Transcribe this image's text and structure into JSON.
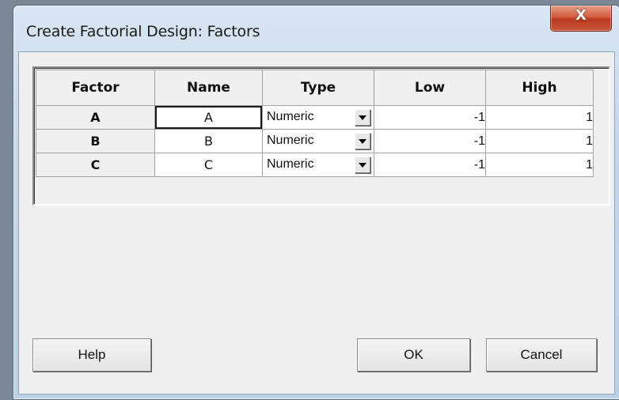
{
  "window": {
    "title": "Create Factorial Design: Factors",
    "close_glyph": "X"
  },
  "grid": {
    "headers": [
      "Factor",
      "Name",
      "Type",
      "Low",
      "High"
    ],
    "rows": [
      {
        "factor": "A",
        "name": "A",
        "type": "Numeric",
        "low": "-1",
        "high": "1"
      },
      {
        "factor": "B",
        "name": "B",
        "type": "Numeric",
        "low": "-1",
        "high": "1"
      },
      {
        "factor": "C",
        "name": "C",
        "type": "Numeric",
        "low": "-1",
        "high": "1"
      }
    ]
  },
  "buttons": {
    "help": "Help",
    "ok": "OK",
    "cancel": "Cancel"
  },
  "icons": {
    "close": "close-icon",
    "dropdown": "chevron-down-icon"
  }
}
